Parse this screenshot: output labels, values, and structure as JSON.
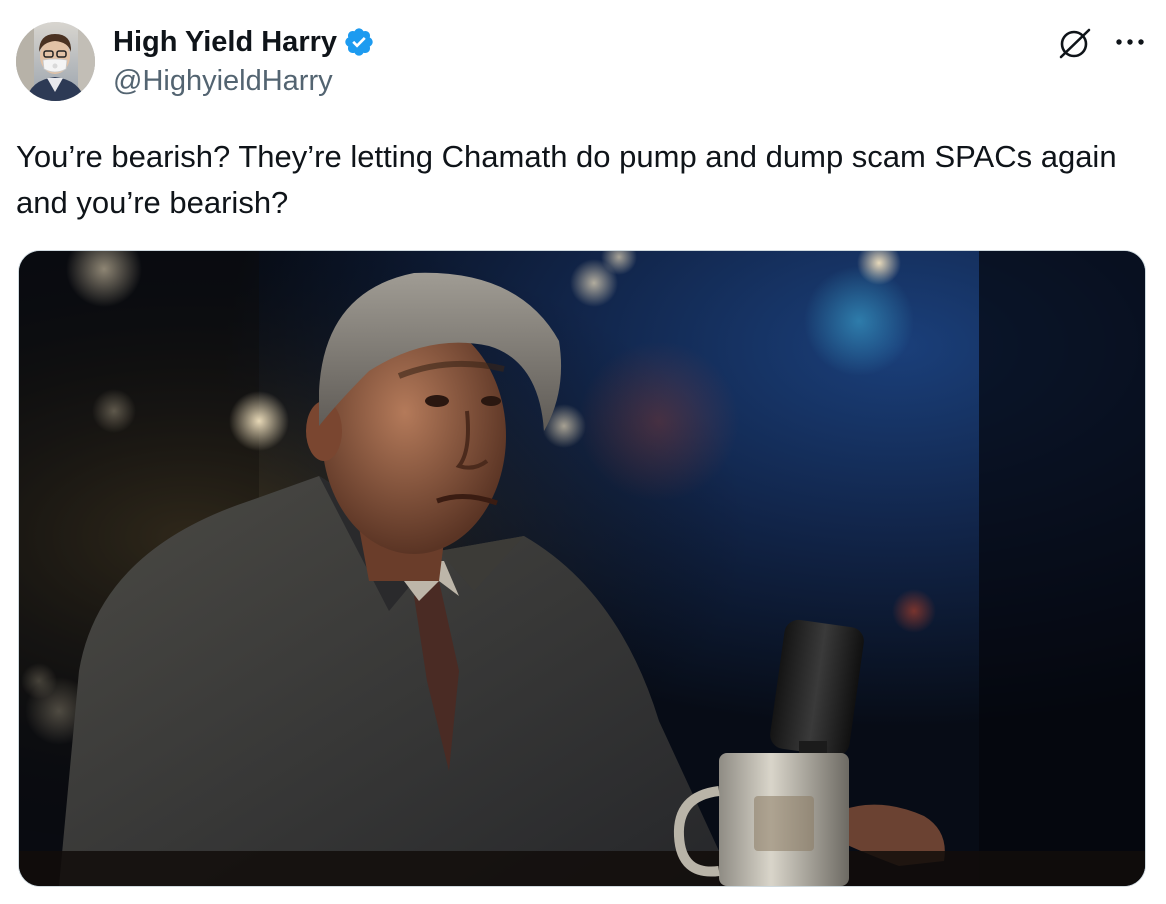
{
  "author": {
    "display_name": "High Yield Harry",
    "handle": "@HighyieldHarry",
    "verified": true,
    "verified_icon": "verified-badge-icon",
    "verified_color": "#1d9bf0"
  },
  "actions": {
    "grok_icon": "grok-icon",
    "more_icon": "more-options-icon"
  },
  "tweet": {
    "text": "You’re bearish? They’re letting Chamath do pump and dump scam SPACs again and you’re bearish?"
  },
  "media": {
    "type": "image",
    "subject": "photo-of-man-in-suit-at-bar"
  },
  "colors": {
    "text_primary": "#0f1419",
    "text_secondary": "#536471",
    "border": "#cfd9de"
  }
}
